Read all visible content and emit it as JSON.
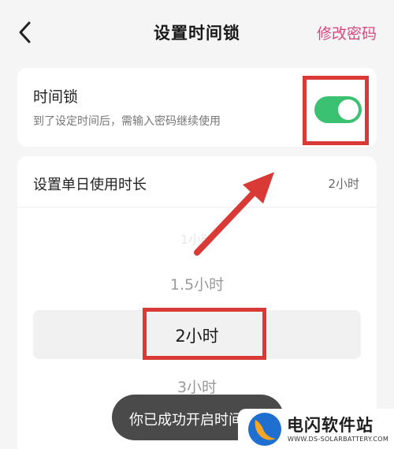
{
  "header": {
    "title": "设置时间锁",
    "action_label": "修改密码",
    "back_icon": "chevron-left-icon"
  },
  "time_lock": {
    "title": "时间锁",
    "description": "到了设定时间后，需输入密码继续使用",
    "enabled": true,
    "toggle_color": "#3bc172"
  },
  "daily_duration": {
    "label": "设置单日使用时长",
    "value": "2小时",
    "picker": {
      "faded_above": "1小时",
      "above": "1.5小时",
      "selected": "2小时",
      "below": "3小时"
    }
  },
  "toast": {
    "message": "你已成功开启时间锁"
  },
  "watermark": {
    "name": "电闪软件站",
    "url": "WWW.DS-SOLARBATTERY.COM"
  },
  "colors": {
    "accent": "#d6487e",
    "annotation_red": "#d93a35",
    "toggle_on": "#3bc172"
  }
}
